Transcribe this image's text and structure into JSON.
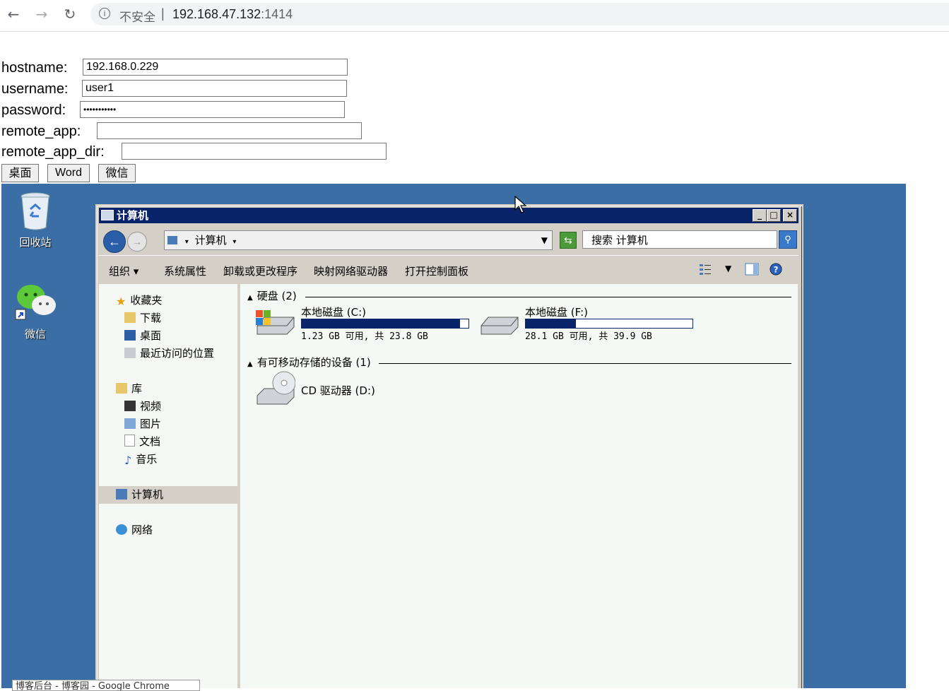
{
  "browser": {
    "security_label": "不安全",
    "separator": "|",
    "url_host": "192.168.47.132",
    "url_port": ":1414"
  },
  "form": {
    "hostname_label": "hostname:",
    "hostname_value": "192.168.0.229",
    "username_label": "username:",
    "username_value": "user1",
    "password_label": "password:",
    "password_value": "•••••••••••",
    "remote_app_label": "remote_app:",
    "remote_app_value": "",
    "remote_app_dir_label": "remote_app_dir:",
    "remote_app_dir_value": ""
  },
  "buttons": {
    "desktop": "桌面",
    "word": "Word",
    "wechat": "微信"
  },
  "desktop_icons": {
    "recycle_bin": "回收站",
    "wechat": "微信"
  },
  "explorer": {
    "title": "计算机",
    "address": "计算机",
    "search_placeholder": "搜索 计算机",
    "toolbar": {
      "organize": "组织",
      "system_properties": "系统属性",
      "uninstall": "卸载或更改程序",
      "map_drive": "映射网络驱动器",
      "control_panel": "打开控制面板"
    },
    "nav": {
      "favorites": "收藏夹",
      "downloads": "下载",
      "desktop": "桌面",
      "recent": "最近访问的位置",
      "libraries": "库",
      "videos": "视频",
      "pictures": "图片",
      "documents": "文档",
      "music": "音乐",
      "computer": "计算机",
      "network": "网络"
    },
    "groups": {
      "hard_disks": "硬盘 (2)",
      "removable": "有可移动存储的设备 (1)"
    },
    "drives": [
      {
        "name": "本地磁盘 (C:)",
        "info": "1.23 GB 可用, 共 23.8 GB",
        "used_fraction": 0.95
      },
      {
        "name": "本地磁盘 (F:)",
        "info": "28.1 GB 可用, 共 39.9 GB",
        "used_fraction": 0.3
      }
    ],
    "cd": {
      "name": "CD 驱动器 (D:)"
    }
  },
  "taskbar_tip": "博客后台 - 博客园 - Google Chrome"
}
